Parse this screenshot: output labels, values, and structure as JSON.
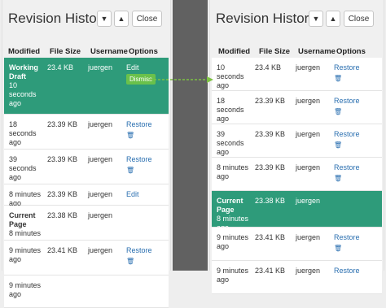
{
  "panels": [
    {
      "title": "Revision History",
      "up_icon": "chevron-down",
      "down_icon": "chevron-up",
      "close_label": "Close",
      "columns": [
        "Modified",
        "File Size",
        "Username",
        "Options"
      ],
      "rows": [
        {
          "modified_bold": "Working Draft",
          "modified": "10 seconds ago",
          "size": "23.4 KB",
          "user": "juergen",
          "option": "Edit",
          "extra": "Dismiss",
          "highlight": true
        },
        {
          "modified_bold": "",
          "modified": "18 seconds ago",
          "size": "23.39 KB",
          "user": "juergen",
          "option": "Restore",
          "trash": true
        },
        {
          "modified_bold": "",
          "modified": "39 seconds ago",
          "size": "23.39 KB",
          "user": "juergen",
          "option": "Restore",
          "trash": true
        },
        {
          "modified_bold": "",
          "modified": "8 minutes ago",
          "size": "23.39 KB",
          "user": "juergen",
          "option": "Edit"
        },
        {
          "modified_bold": "Current Page",
          "modified": "8 minutes ago",
          "size": "23.38 KB",
          "user": "juergen",
          "option": ""
        },
        {
          "modified_bold": "",
          "modified": "9 minutes ago",
          "size": "23.41 KB",
          "user": "juergen",
          "option": "Restore",
          "trash": true
        },
        {
          "modified_bold": "",
          "modified": "9 minutes ago",
          "size": "",
          "user": "",
          "option": ""
        }
      ]
    },
    {
      "title": "Revision History",
      "up_icon": "chevron-down",
      "down_icon": "chevron-up",
      "close_label": "Close",
      "columns": [
        "Modified",
        "File Size",
        "Username",
        "Options"
      ],
      "rows": [
        {
          "modified_bold": "",
          "modified": "10 seconds ago",
          "size": "23.4 KB",
          "user": "juergen",
          "option": "Restore",
          "trash": true
        },
        {
          "modified_bold": "",
          "modified": "18 seconds ago",
          "size": "23.39 KB",
          "user": "juergen",
          "option": "Restore",
          "trash": true
        },
        {
          "modified_bold": "",
          "modified": "39 seconds ago",
          "size": "23.39 KB",
          "user": "juergen",
          "option": "Restore",
          "trash": true
        },
        {
          "modified_bold": "",
          "modified": "8 minutes ago",
          "size": "23.39 KB",
          "user": "juergen",
          "option": "Restore",
          "trash": true
        },
        {
          "modified_bold": "Current Page",
          "modified": "8 minutes ago",
          "size": "23.38 KB",
          "user": "juergen",
          "option": "",
          "highlight": true
        },
        {
          "modified_bold": "",
          "modified": "9 minutes ago",
          "size": "23.41 KB",
          "user": "juergen",
          "option": "Restore",
          "trash": true
        },
        {
          "modified_bold": "",
          "modified": "9 minutes ago",
          "size": "23.41 KB",
          "user": "juergen",
          "option": "Restore"
        }
      ]
    }
  ],
  "colors": {
    "highlight": "#2e9b7a",
    "link": "#2a6fb0",
    "dismiss": "#6ac14b",
    "divider": "#616161",
    "arrow": "#7dc242"
  }
}
